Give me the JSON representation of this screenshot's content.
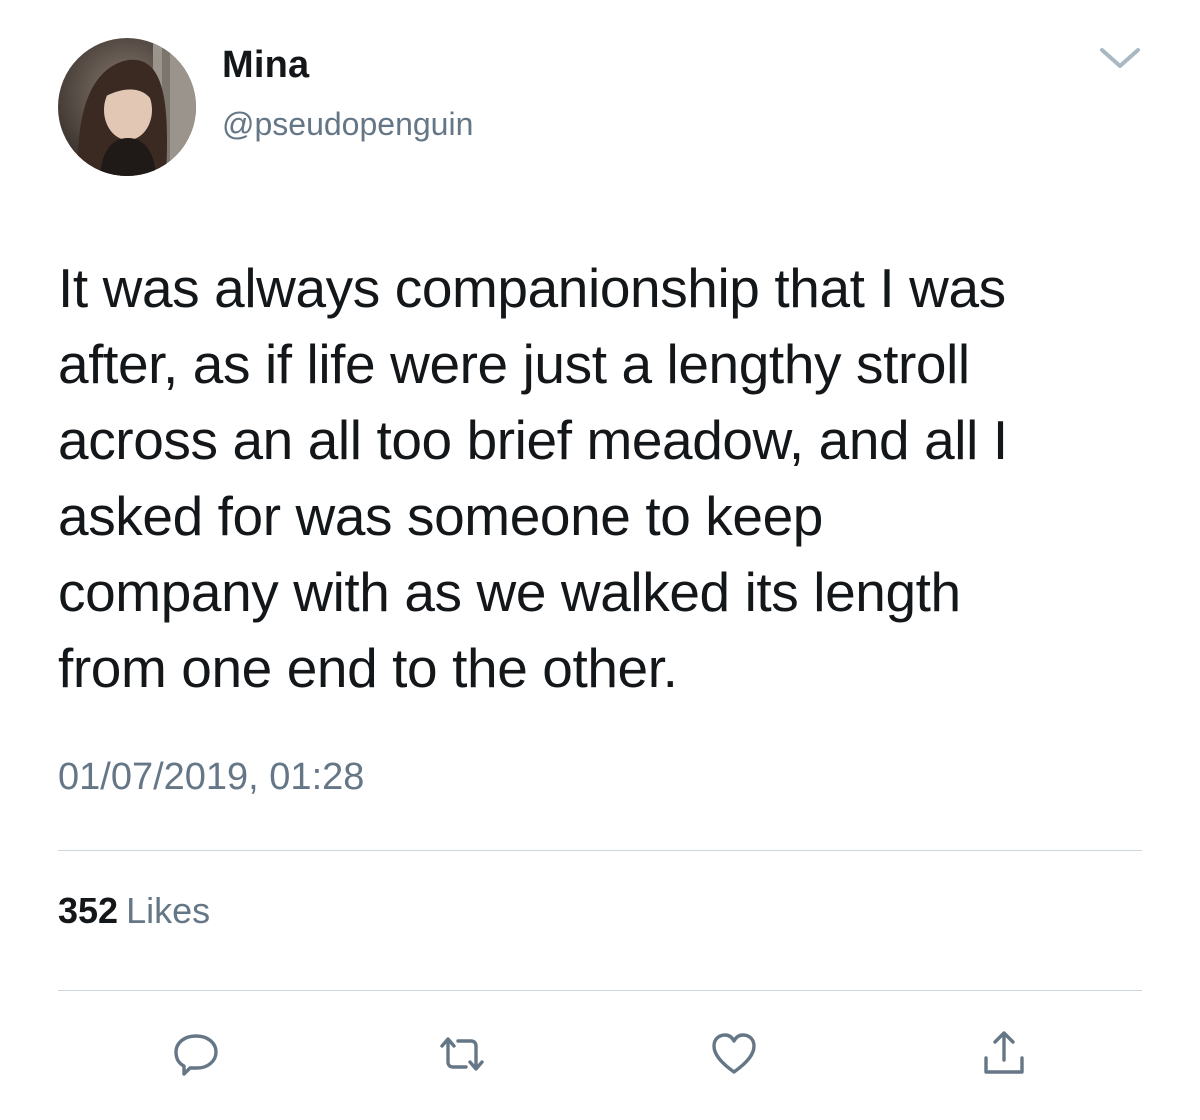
{
  "user": {
    "display_name": "Mina",
    "handle": "@pseudopenguin"
  },
  "tweet": {
    "text": "It was always companionship that I was\nafter, as if life were just a lengthy stroll\nacross an all too brief meadow, and all I\nasked for was someone to keep\ncompany with as we walked its length\nfrom one end to the other.",
    "timestamp": "01/07/2019, 01:28"
  },
  "stats": {
    "likes_count": "352",
    "likes_label": "Likes"
  },
  "icons": {
    "menu": "chevron-down-icon",
    "reply": "reply-icon",
    "retweet": "retweet-icon",
    "like": "heart-icon",
    "share": "share-icon"
  },
  "colors": {
    "text_primary": "#14171a",
    "text_secondary": "#657786",
    "divider": "#ccd6dd"
  }
}
